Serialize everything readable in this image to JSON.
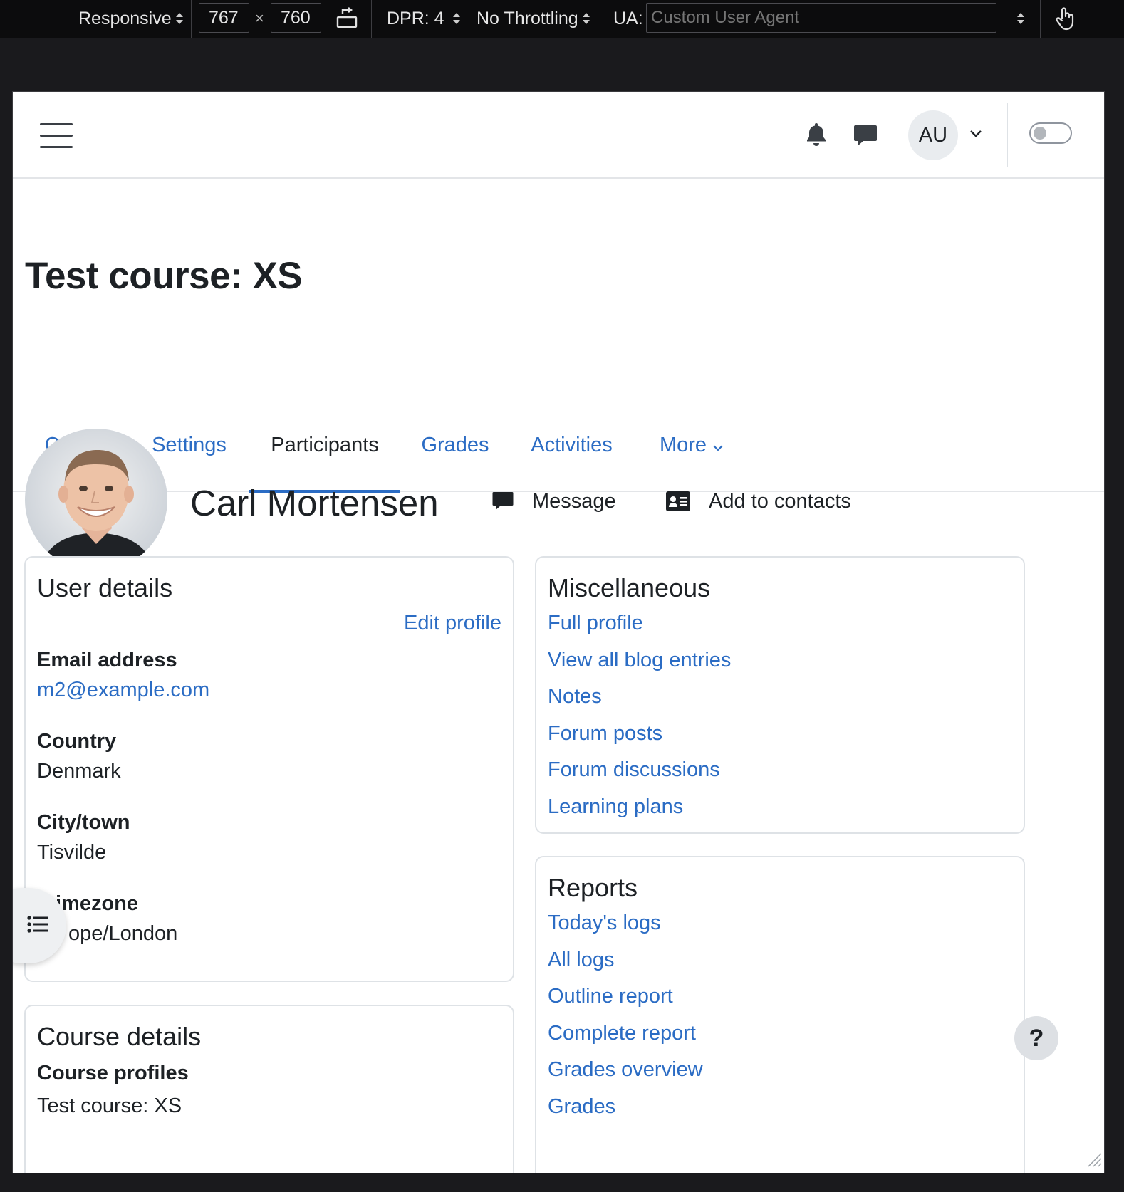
{
  "devtools": {
    "device": "Responsive",
    "width": "767",
    "times": "×",
    "height": "760",
    "dpr": "DPR: 4",
    "throttling": "No Throttling",
    "ua_label": "UA:",
    "ua_placeholder": "Custom User Agent"
  },
  "navbar": {
    "avatar_initials": "AU"
  },
  "course": {
    "title": "Test course: XS"
  },
  "tabs": [
    {
      "label": "Course"
    },
    {
      "label": "Settings"
    },
    {
      "label": "Participants",
      "active": true
    },
    {
      "label": "Grades"
    },
    {
      "label": "Activities"
    },
    {
      "label": "More"
    }
  ],
  "profile": {
    "name": "Carl Mortensen",
    "message_label": "Message",
    "add_contact_label": "Add to contacts"
  },
  "user_details": {
    "heading": "User details",
    "edit_link": "Edit profile",
    "fields": [
      {
        "label": "Email address",
        "value": "m2@example.com"
      },
      {
        "label": "Country",
        "value": "Denmark"
      },
      {
        "label": "City/town",
        "value": "Tisvilde"
      },
      {
        "label": "imezone",
        "value": "ope/London"
      }
    ]
  },
  "course_details": {
    "heading": "Course details",
    "profiles_label": "Course profiles",
    "profiles_value_partial": "Test course: XS"
  },
  "miscellaneous": {
    "heading": "Miscellaneous",
    "links": [
      "Full profile",
      "View all blog entries",
      "Notes",
      "Forum posts",
      "Forum discussions",
      "Learning plans"
    ]
  },
  "reports": {
    "heading": "Reports",
    "links": [
      "Today's logs",
      "All logs",
      "Outline report",
      "Complete report",
      "Grades overview",
      "Grades"
    ]
  },
  "help": {
    "label": "?"
  },
  "colors": {
    "link": "#2b6cc4",
    "text": "#1d2125",
    "border": "#dee2e6"
  }
}
